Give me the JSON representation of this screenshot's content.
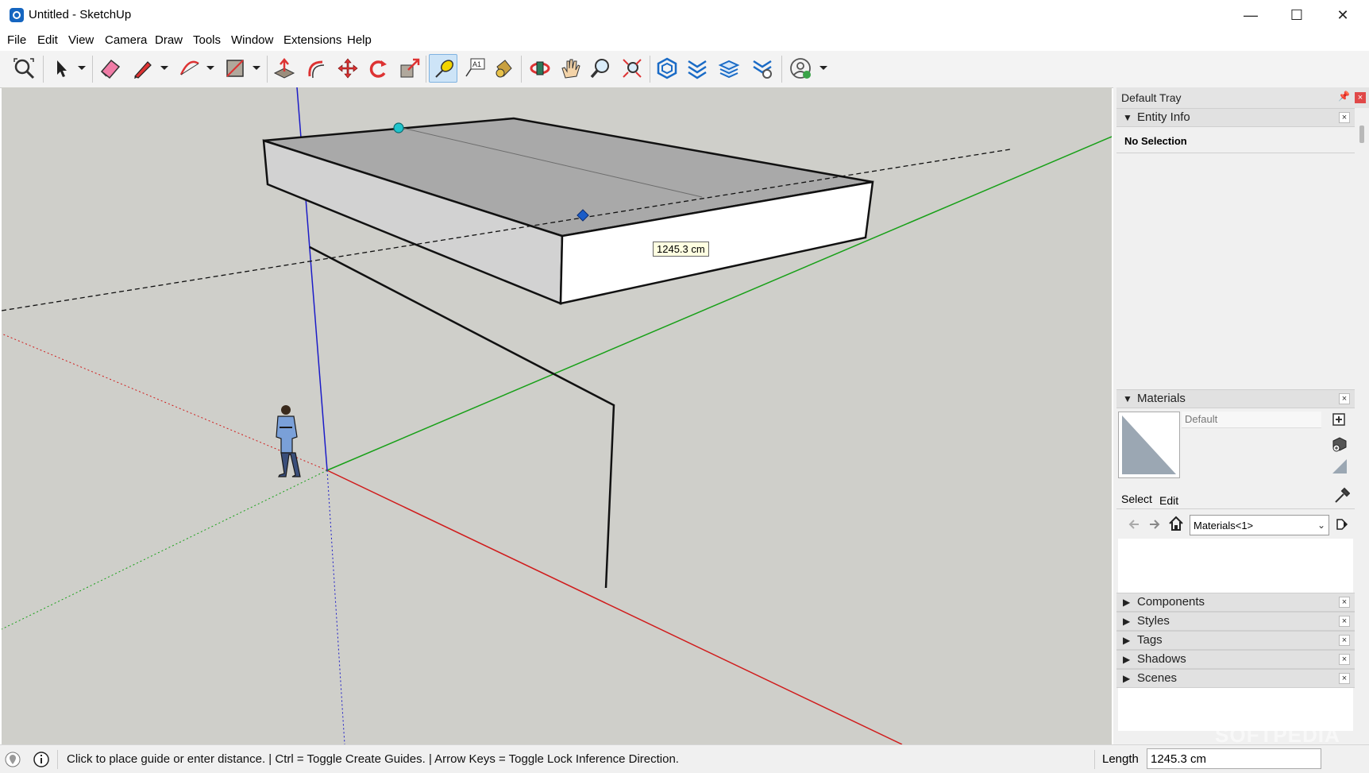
{
  "window": {
    "title": "Untitled - SketchUp",
    "minimize": "—",
    "maximize": "☐",
    "close": "✕"
  },
  "menu": [
    "File",
    "Edit",
    "View",
    "Camera",
    "Draw",
    "Tools",
    "Window",
    "Extensions",
    "Help"
  ],
  "toolbar": {
    "tools": [
      "zoom-extents",
      "select",
      "eraser",
      "pencil-line",
      "arc",
      "shape-rectangle",
      "push-pull",
      "follow-me",
      "move",
      "rotate",
      "scale",
      "tape-measure",
      "text",
      "paint-bucket",
      "orbit",
      "pan",
      "zoom",
      "zoom-window",
      "warehouse",
      "extension-warehouse",
      "layout",
      "extension-manager",
      "account"
    ],
    "active_tool": "tape-measure"
  },
  "viewport": {
    "measure_tooltip": "1245.3 cm",
    "axis_colors": {
      "red": "#d01c1c",
      "green": "#18a018",
      "blue": "#1c1cc8"
    }
  },
  "tray": {
    "title": "Default Tray",
    "pin": "📌",
    "close": "×",
    "entity_info": {
      "label": "Entity Info",
      "status": "No Selection"
    },
    "materials": {
      "label": "Materials",
      "current_material": "Default",
      "select_tab": "Select",
      "edit_tab": "Edit",
      "library": "Materials<1>"
    },
    "collapsed_panels": [
      "Components",
      "Styles",
      "Tags",
      "Shadows",
      "Scenes"
    ],
    "panel_close": "×",
    "expanded_arrow": "▼",
    "collapsed_arrow": "▶"
  },
  "status_bar": {
    "hint": "Click to place guide or enter distance. | Ctrl = Toggle Create Guides. | Arrow Keys = Toggle Lock Inference Direction.",
    "length_label": "Length",
    "length_value": "1245.3 cm"
  },
  "watermark": "SOFTPEDIA"
}
